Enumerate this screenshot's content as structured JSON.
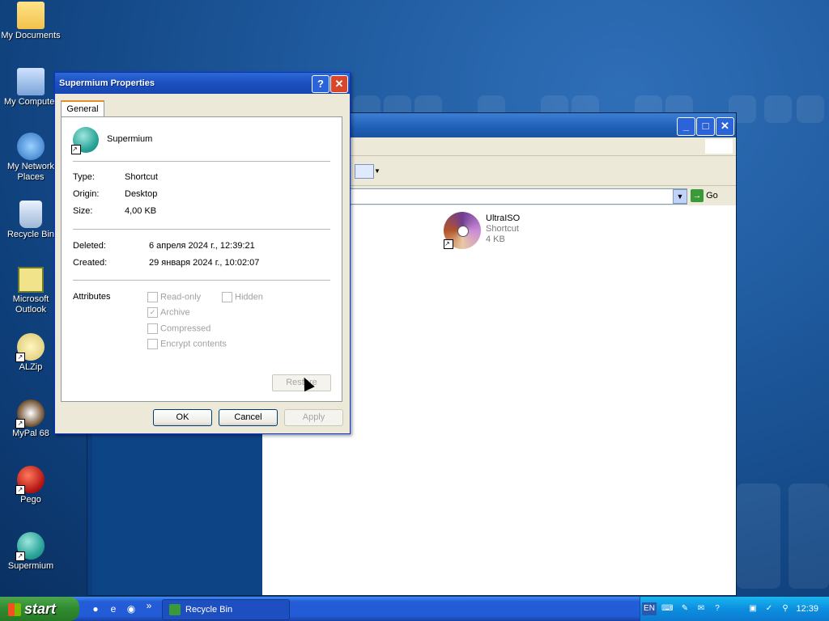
{
  "desktop": {
    "icons": [
      {
        "label": "My Documents"
      },
      {
        "label": "My Computer"
      },
      {
        "label": "My Network Places"
      },
      {
        "label": "Recycle Bin"
      },
      {
        "label": "Microsoft Outlook"
      },
      {
        "label": "ALZip"
      },
      {
        "label": "MyPal 68"
      },
      {
        "label": "Pego"
      },
      {
        "label": "Supermium"
      }
    ]
  },
  "explorer": {
    "address_go": "Go",
    "item": {
      "name": "UltraISO",
      "type": "Shortcut",
      "size": "4 KB"
    }
  },
  "dialog": {
    "title": "Supermium Properties",
    "help": "?",
    "close": "✕",
    "tab": "General",
    "file_name": "Supermium",
    "type_label": "Type:",
    "type_value": "Shortcut",
    "origin_label": "Origin:",
    "origin_value": "Desktop",
    "size_label": "Size:",
    "size_value": "4,00 KB",
    "deleted_label": "Deleted:",
    "deleted_value": "6 апреля 2024 г., 12:39:21",
    "created_label": "Created:",
    "created_value": "29 января 2024 г., 10:02:07",
    "attributes_label": "Attributes",
    "attributes": {
      "readonly": "Read-only",
      "hidden": "Hidden",
      "archive": "Archive",
      "compressed": "Compressed",
      "encrypt": "Encrypt contents"
    },
    "restore": "Restore",
    "ok": "OK",
    "cancel": "Cancel",
    "apply": "Apply"
  },
  "taskbar": {
    "start": "start",
    "task": "Recycle Bin",
    "lang": "EN",
    "clock": "12:39"
  }
}
